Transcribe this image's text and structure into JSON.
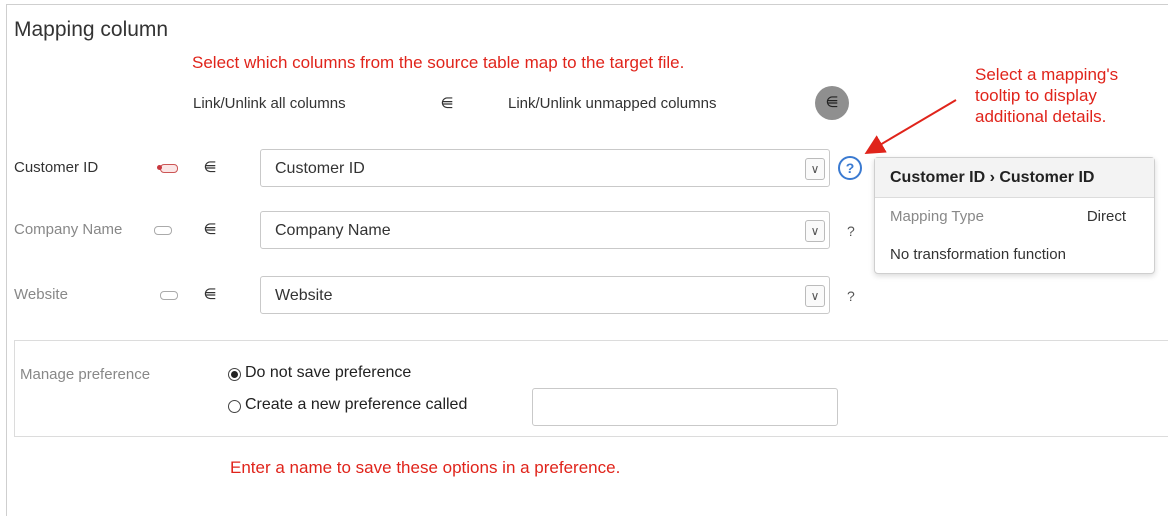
{
  "panel": {
    "title": "Mapping column"
  },
  "annotations": {
    "top": "Select which columns from the source table map to the target file.",
    "right_lines": [
      "Select a mapping's",
      "tooltip to display",
      "additional details."
    ],
    "bottom": "Enter a name to save these options in a preference."
  },
  "link_controls": {
    "link_all_label": "Link/Unlink all columns",
    "link_unmapped_label": "Link/Unlink unmapped columns"
  },
  "rows": [
    {
      "label": "Customer ID",
      "selected": "Customer ID",
      "help": "?"
    },
    {
      "label": "Company Name",
      "selected": "Company Name",
      "help": "?"
    },
    {
      "label": "Website",
      "selected": "Website",
      "help": "?"
    }
  ],
  "tooltip": {
    "header": "Customer ID › Customer ID",
    "type_label": "Mapping Type",
    "type_value": "Direct",
    "note": "No transformation function"
  },
  "preference": {
    "label": "Manage preference",
    "option_none": "Do not save preference",
    "option_new": "Create a new preference called",
    "name_value": ""
  },
  "colors": {
    "annotation": "#e0241b",
    "help_blue": "#3a7ad1"
  },
  "icons": {
    "plug": "plug-icon",
    "help": "help-circle-icon",
    "dropdown": "chevron-down-icon"
  }
}
